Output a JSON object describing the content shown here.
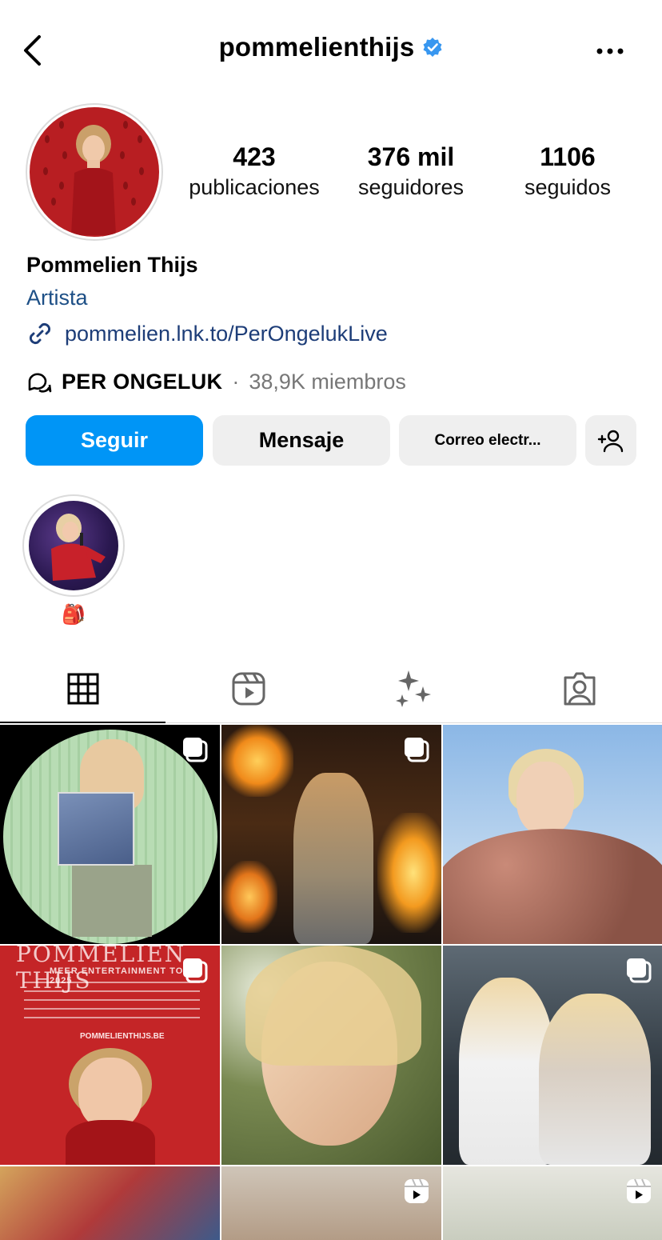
{
  "header": {
    "username": "pommelienthijs",
    "verified": true
  },
  "profile": {
    "stats": [
      {
        "value": "423",
        "label": "publicaciones"
      },
      {
        "value": "376 mil",
        "label": "seguidores"
      },
      {
        "value": "1106",
        "label": "seguidos"
      }
    ],
    "full_name": "Pommelien Thijs",
    "category": "Artista",
    "link": "pommelien.lnk.to/PerOngelukLive",
    "channel": {
      "name": "PER ONGELUK",
      "separator": "·",
      "members": "38,9K miembros"
    }
  },
  "actions": {
    "follow": "Seguir",
    "message": "Mensaje",
    "email": "Correo electr..."
  },
  "highlights": [
    {
      "label": "🎒"
    }
  ],
  "tabs": [
    {
      "name": "grid",
      "active": true
    },
    {
      "name": "reels",
      "active": false
    },
    {
      "name": "effects",
      "active": false
    },
    {
      "name": "tagged",
      "active": false
    }
  ],
  "poster": {
    "title": "POMMELIEN THIJS",
    "subtitle": "MEER ENTERTAINMENT TOUR 2025",
    "site": "POMMELIENTHIJS.BE"
  },
  "colors": {
    "accent": "#0095f6",
    "verified": "#3897f0",
    "link": "#1d3d78"
  }
}
